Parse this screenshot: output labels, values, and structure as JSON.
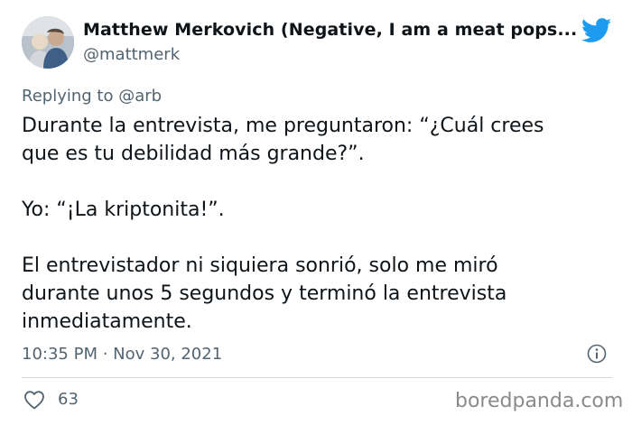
{
  "author": {
    "name": "Matthew Merkovich (Negative, I am a meat pops...",
    "handle": "@mattmerk"
  },
  "reply": {
    "prefix": "Replying to ",
    "mention": "@arb"
  },
  "tweet": {
    "lines": [
      "Durante la entrevista, me preguntaron: “¿Cuál crees",
      "que es tu debilidad más grande?”.",
      "Yo: “¡La kriptonita!”.",
      "El entrevistador ni siquiera sonrió, solo me miró",
      "durante unos 5 segundos y terminó la entrevista",
      "inmediatamente."
    ]
  },
  "meta": {
    "timestamp": "10:35 PM · Nov 30, 2021",
    "likes": "63"
  },
  "watermark": "boredpanda.com",
  "colors": {
    "brand": "#1d9bf0",
    "secondary_text": "#536471"
  },
  "icons": {
    "logo": "twitter-bird-icon",
    "info": "info-icon",
    "like": "heart-icon"
  }
}
